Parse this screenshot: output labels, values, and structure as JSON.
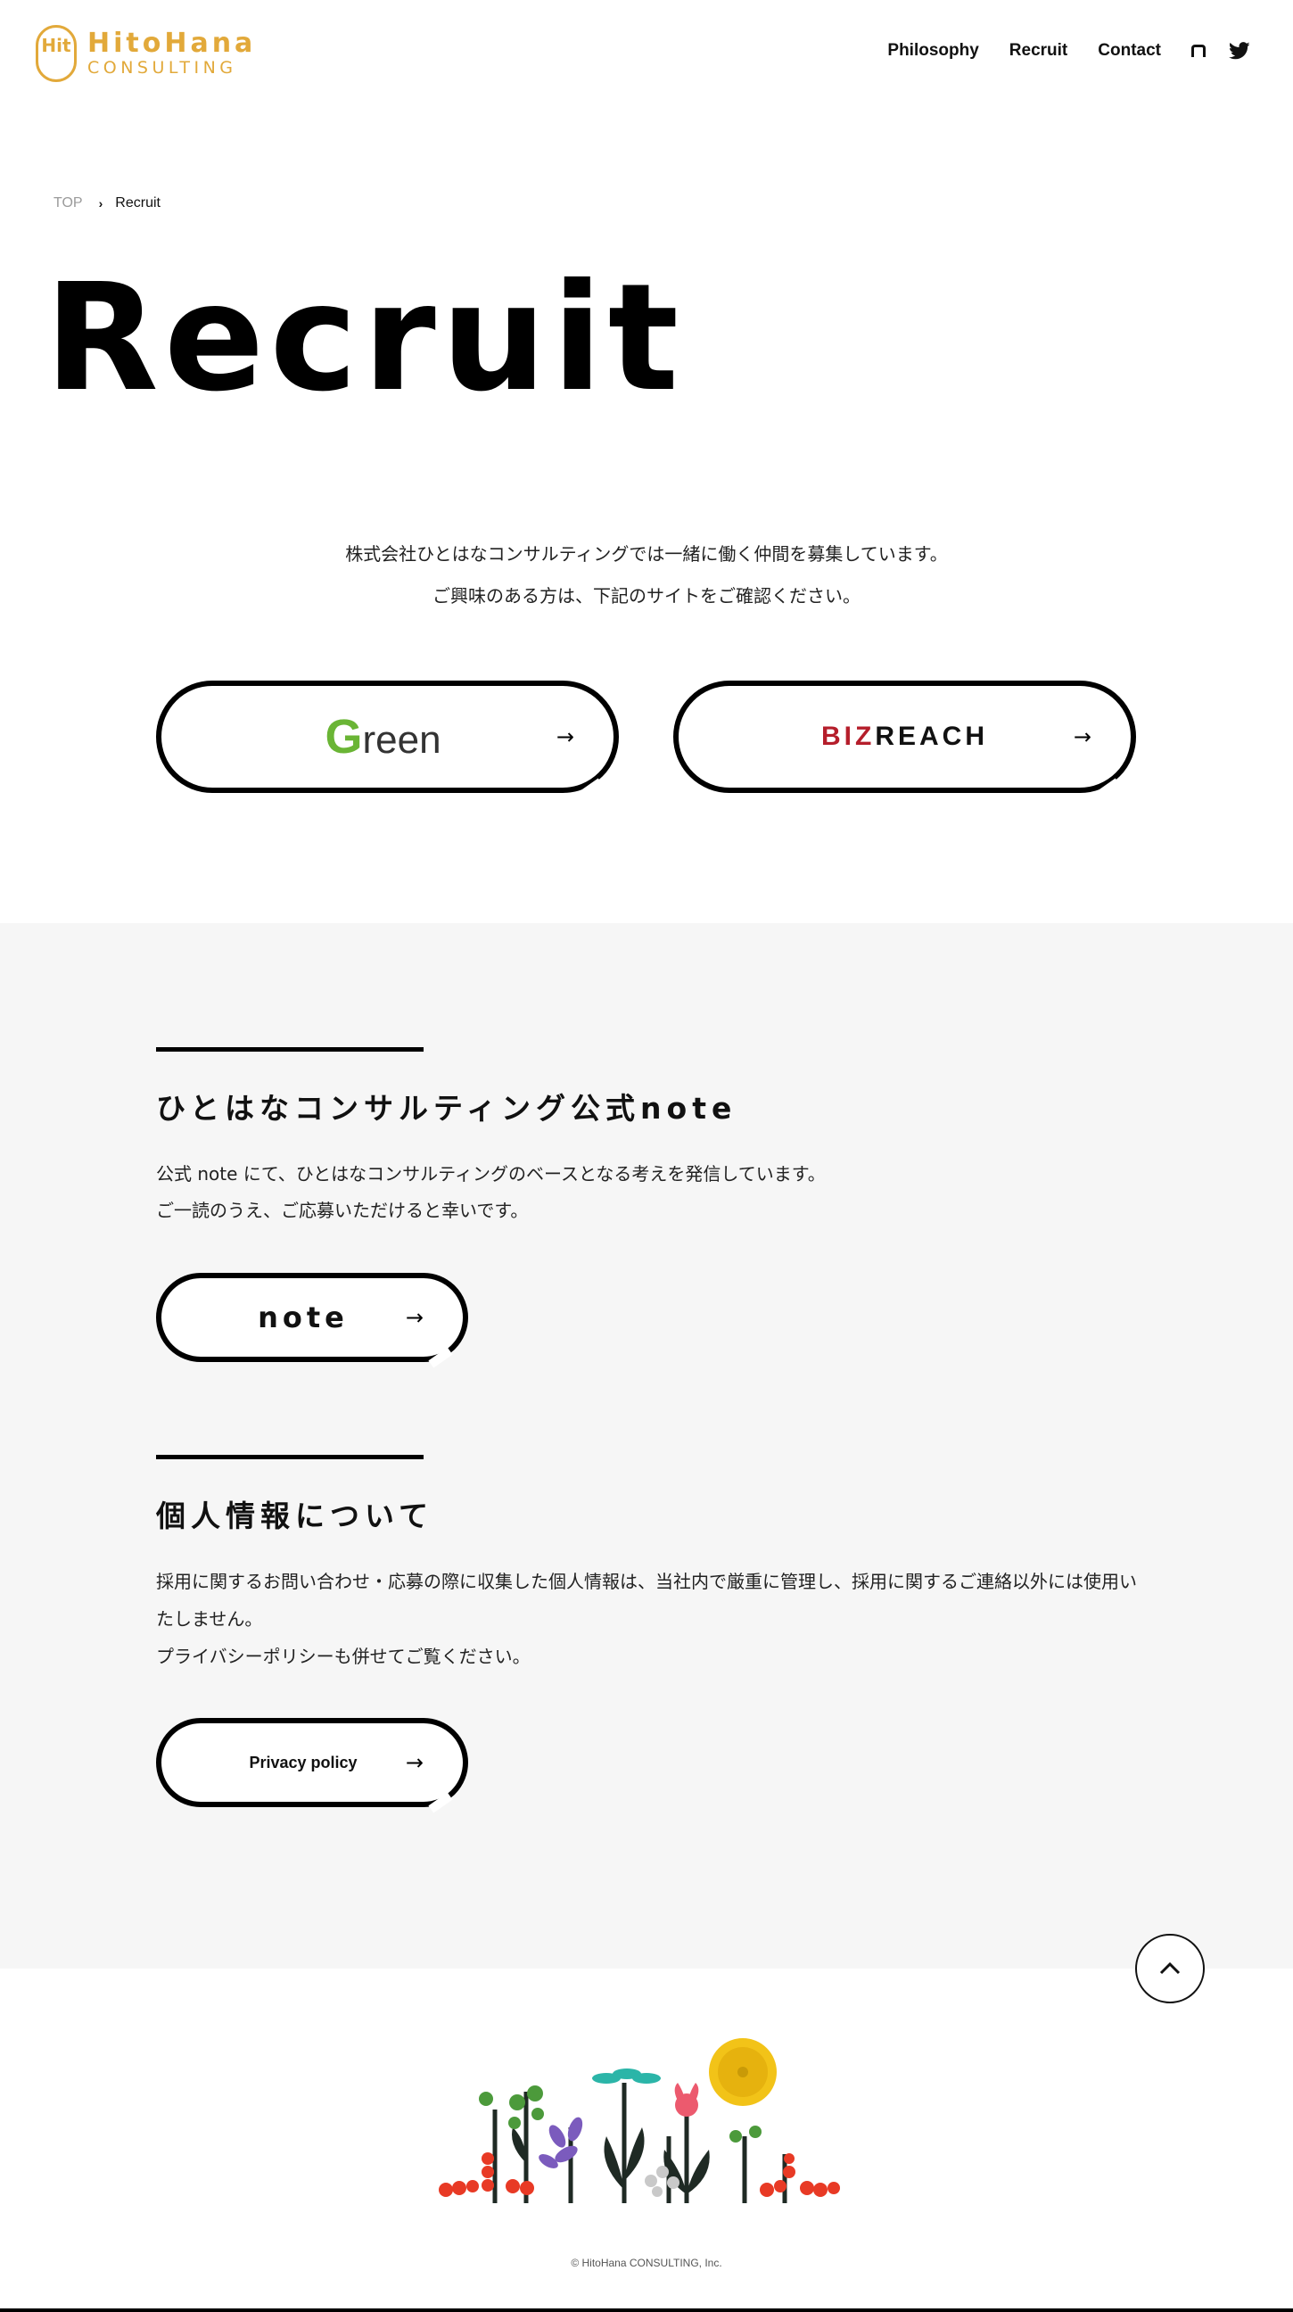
{
  "header": {
    "logo_mark": "Hit",
    "logo_line1": "HitoHana",
    "logo_line2": "CONSULTING",
    "nav": [
      "Philosophy",
      "Recruit",
      "Contact"
    ],
    "icons": [
      "note-icon",
      "twitter-icon"
    ],
    "accent_color": "#e2a93a"
  },
  "breadcrumb": {
    "top": "TOP",
    "separator": "›",
    "current": "Recruit"
  },
  "page_title": "Recruit",
  "intro": {
    "line1": "株式会社ひとはなコンサルティングでは一緒に働く仲間を募集しています。",
    "line2": "ご興味のある方は、下記のサイトをご確認ください。"
  },
  "recruit_links": {
    "green": {
      "g": "G",
      "rest": "reen",
      "arrow": "→"
    },
    "bizreach": {
      "biz": "BIZ",
      "reach": "REACH",
      "arrow": "→"
    }
  },
  "note_section": {
    "title": "ひとはなコンサルティング公式note",
    "line1": "公式 note にて、ひとはなコンサルティングのベースとなる考えを発信しています。",
    "line2": "ご一読のうえ、ご応募いただけると幸いです。",
    "button_label": "note",
    "arrow": "→"
  },
  "privacy_section": {
    "title": "個人情報について",
    "line1": "採用に関するお問い合わせ・応募の際に収集した個人情報は、当社内で厳重に管理し、採用に関するご連絡以外には使用いたしません。",
    "line2": "プライバシーポリシーも併せてご覧ください。",
    "button_label": "Privacy policy",
    "arrow": "→"
  },
  "footer": {
    "copyright": "© HitoHana CONSULTING, Inc."
  }
}
